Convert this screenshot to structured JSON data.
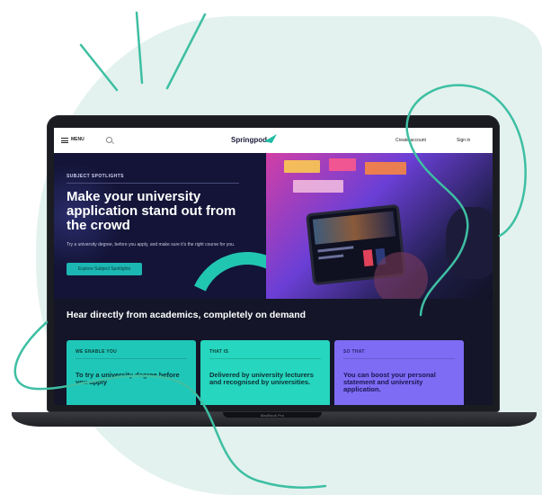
{
  "nav": {
    "menu_label": "MENU",
    "logo_text": "Springpod",
    "create_account": "Create account",
    "sign_in": "Sign in"
  },
  "hero": {
    "eyebrow": "SUBJECT SPOTLIGHTS",
    "title": "Make your university application stand out from the crowd",
    "subtitle": "Try a university degree, before you apply, and make sure it's the right course for you.",
    "cta": "Explore Subject Spotlights"
  },
  "band": {
    "title": "Hear directly from academics, completely on demand"
  },
  "cards": [
    {
      "label": "WE ENABLE YOU",
      "body": "To try a university degree before you apply",
      "color": "#1fc7b8"
    },
    {
      "label": "THAT IS",
      "body": "Delivered by university lecturers and recognised by universities.",
      "color": "#26d6be"
    },
    {
      "label": "SO THAT",
      "body": "You can boost your personal statement and university application.",
      "color": "#7e6cf5"
    }
  ],
  "device": {
    "label": "MacBook Pro"
  },
  "colors": {
    "accent": "#1fbda6",
    "navy": "#141528",
    "blob": "#e3f2ee"
  }
}
